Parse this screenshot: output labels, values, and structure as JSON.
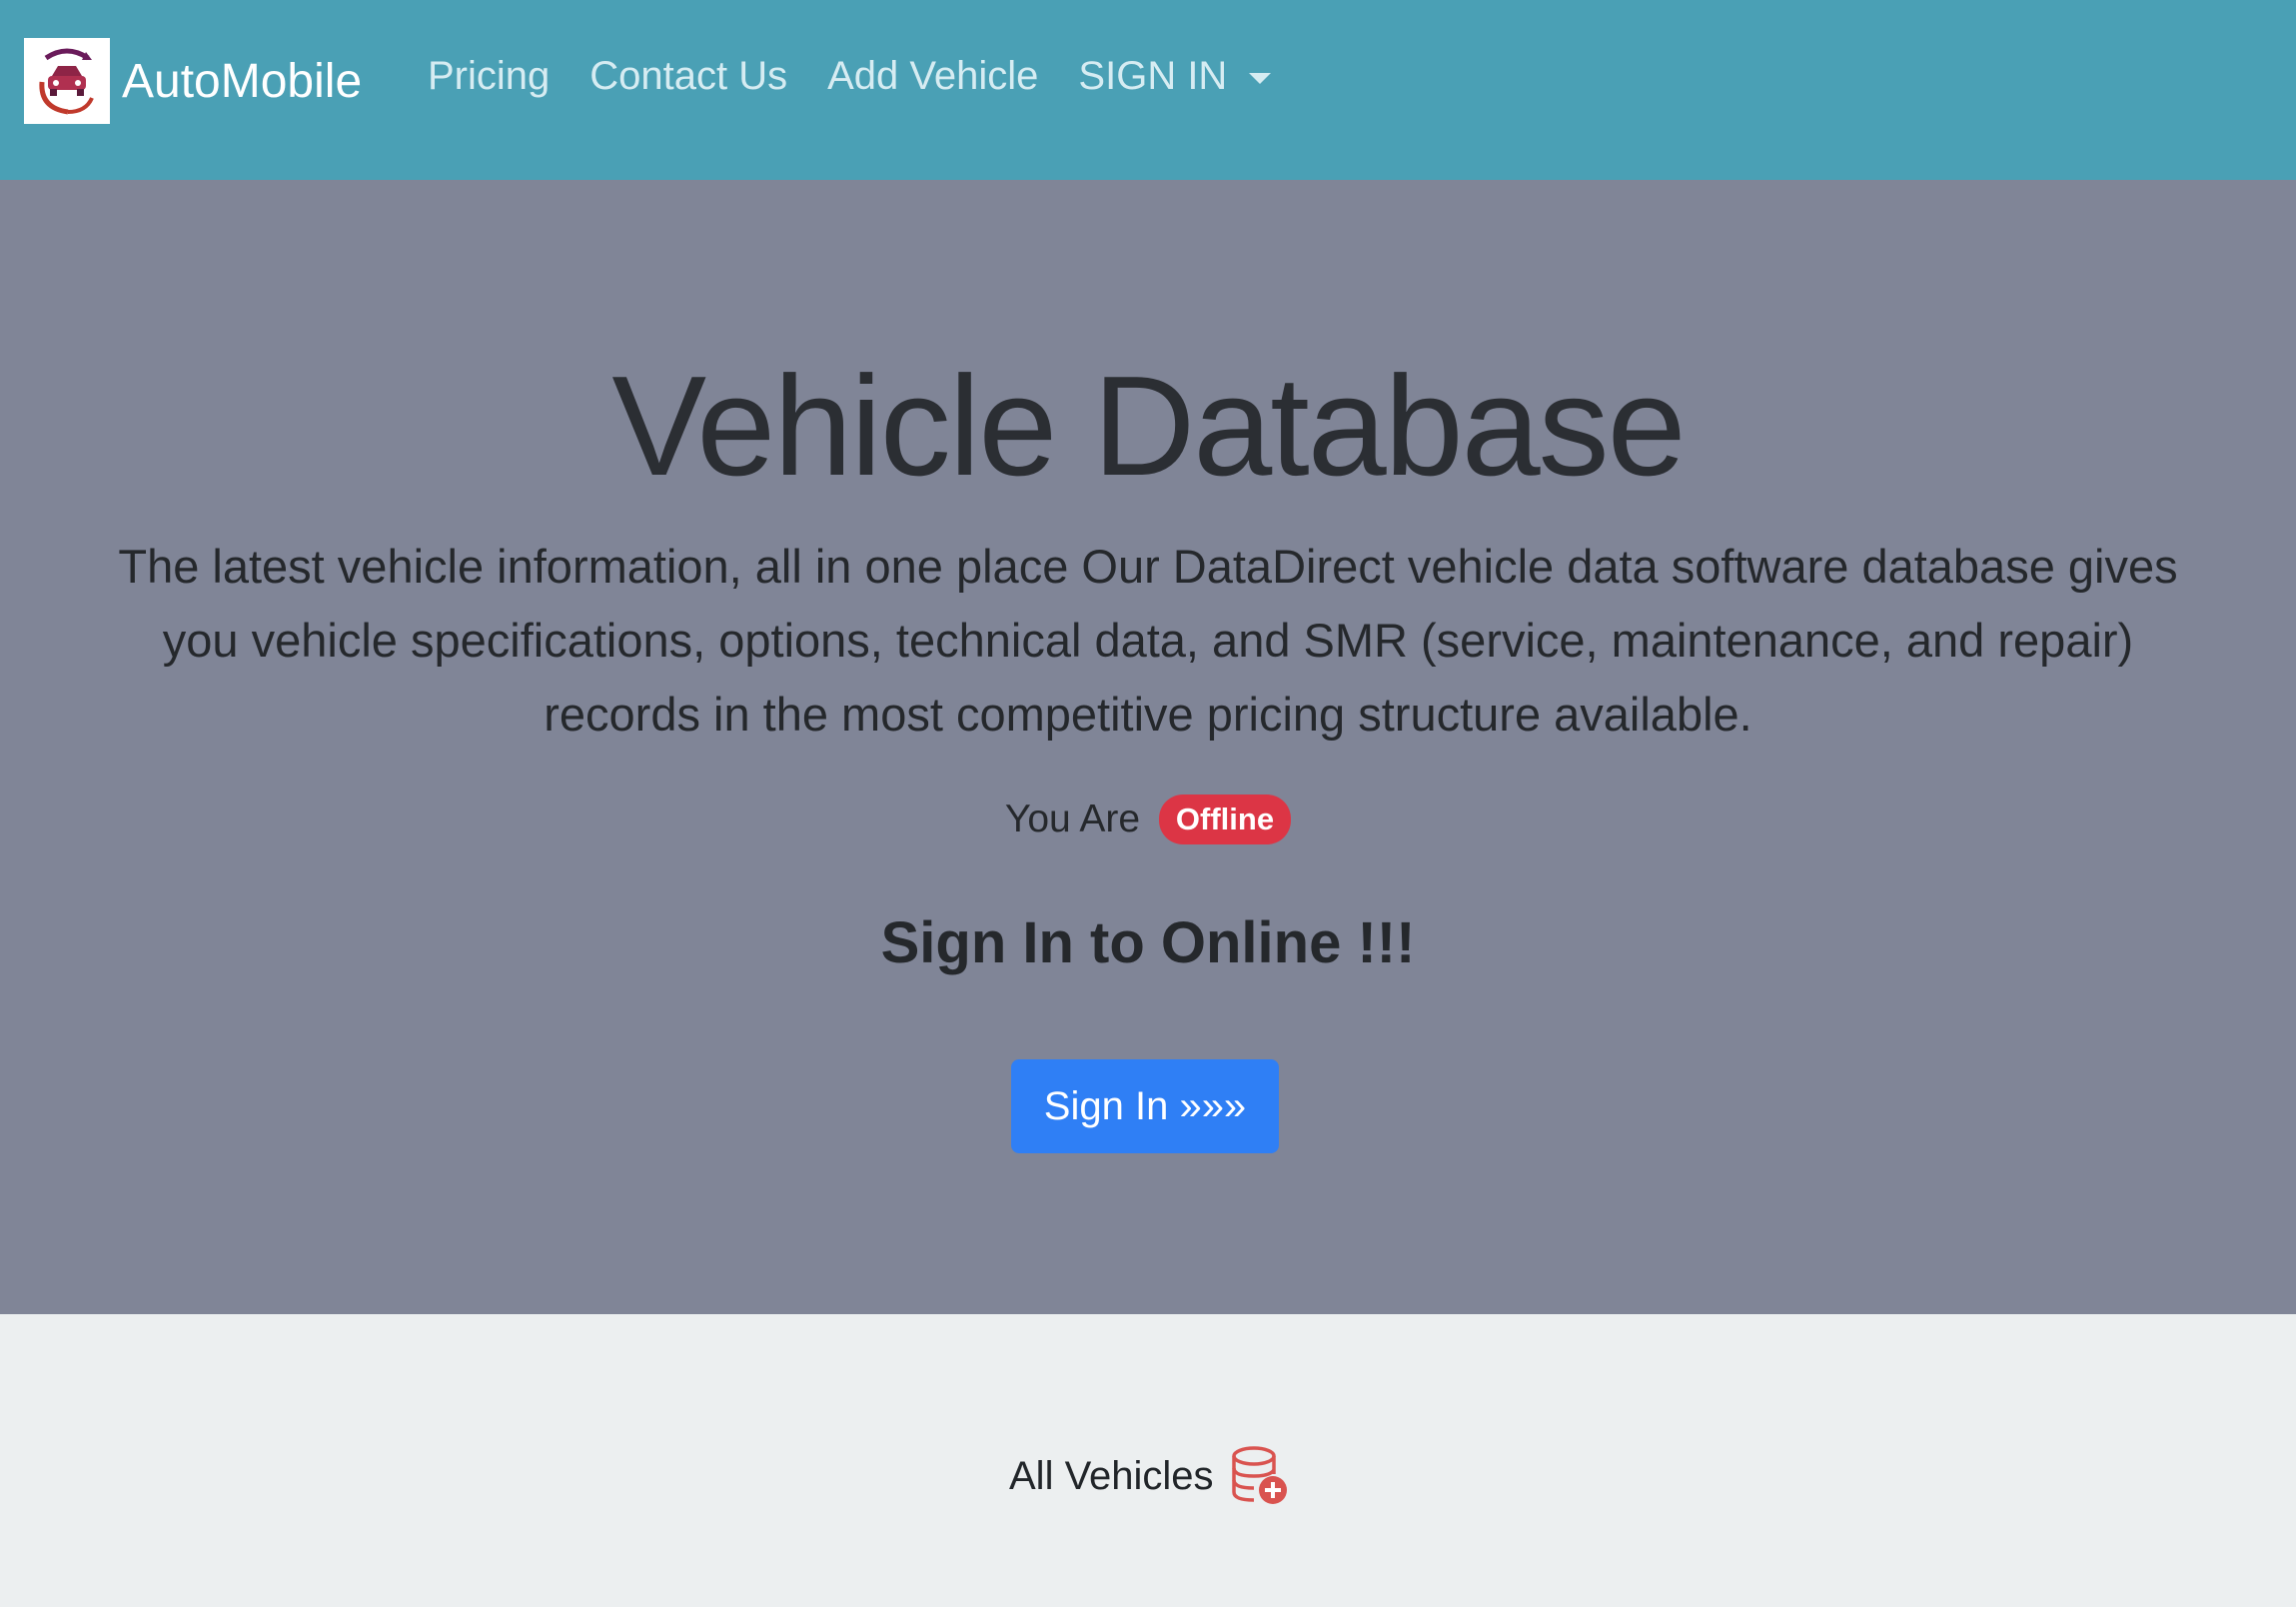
{
  "navbar": {
    "brand": "AutoMobile",
    "logo_icon": "car-logo-icon",
    "links": [
      "Pricing",
      "Contact Us",
      "Add Vehicle"
    ],
    "dropdown_label": "SIGN IN",
    "background": "#4aa0b5"
  },
  "hero": {
    "title": "Vehicle Database",
    "lead": "The latest vehicle information, all in one place Our DataDirect vehicle data software database gives you vehicle specifications, options, technical data, and SMR (service, maintenance, and repair) records in the most competitive pricing structure available.",
    "status_prefix": "You Are",
    "status_badge": "Offline",
    "cta_heading": "Sign In to Online !!!",
    "signin_button": "Sign In »»»",
    "background": "#808597"
  },
  "bottom": {
    "all_vehicles_label": "All Vehicles",
    "icon": "database-add-icon"
  },
  "colors": {
    "accent": "#2f7ff5",
    "badge": "#dc3545"
  }
}
